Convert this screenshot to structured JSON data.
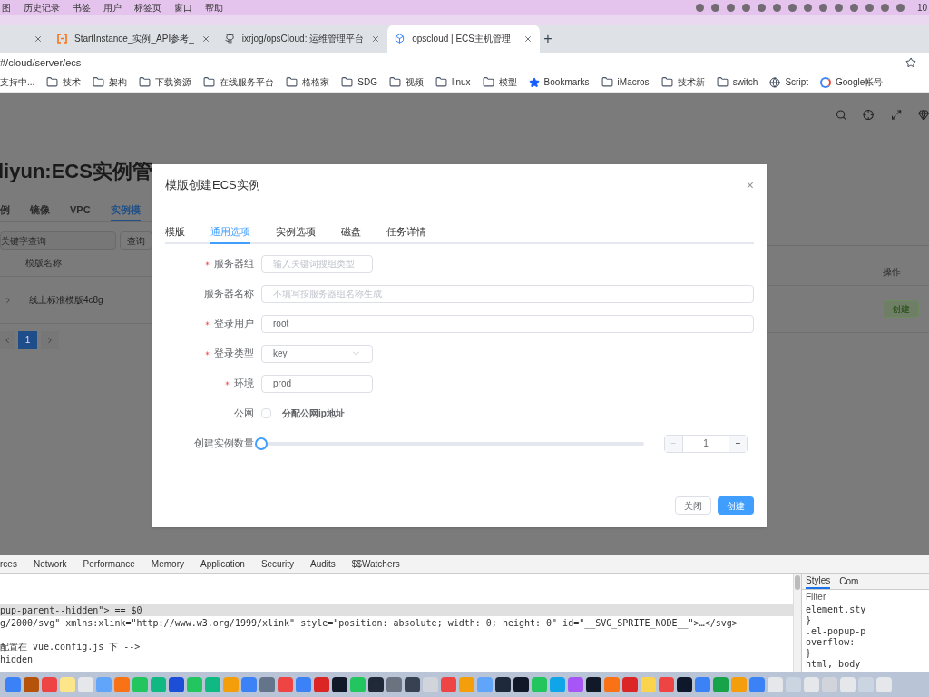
{
  "menu_bar": {
    "items": [
      "图",
      "历史记录",
      "书签",
      "用户",
      "标签页",
      "窗口",
      "帮助"
    ],
    "clock": "10"
  },
  "browser_tabs": [
    {
      "selected": false
    },
    {
      "title": "StartInstance_实例_API参考_",
      "selected": false
    },
    {
      "title": "ixrjog/opsCloud: 运维管理平台",
      "selected": false
    },
    {
      "title": "opscloud | ECS主机管理",
      "selected": true
    }
  ],
  "new_tab": "+",
  "address": "#/cloud/server/ecs",
  "bookmarks": [
    {
      "label": "支持中...",
      "kind": "text"
    },
    {
      "label": "技术",
      "kind": "folder"
    },
    {
      "label": "架构",
      "kind": "folder"
    },
    {
      "label": "下载资源",
      "kind": "folder"
    },
    {
      "label": "在线服务平台",
      "kind": "folder"
    },
    {
      "label": "格格家",
      "kind": "folder"
    },
    {
      "label": "SDG",
      "kind": "folder"
    },
    {
      "label": "视频",
      "kind": "folder"
    },
    {
      "label": "linux",
      "kind": "folder"
    },
    {
      "label": "模型",
      "kind": "folder"
    },
    {
      "label": "Bookmarks",
      "kind": "star"
    },
    {
      "label": "iMacros",
      "kind": "folder"
    },
    {
      "label": "技术新",
      "kind": "folder"
    },
    {
      "label": "switch",
      "kind": "folder"
    },
    {
      "label": "Script",
      "kind": "globe"
    },
    {
      "label": "Google帐号",
      "kind": "google"
    }
  ],
  "page": {
    "title": "liyun:ECS实例管",
    "tabs": [
      {
        "label": "例",
        "selected": false
      },
      {
        "label": "镜像",
        "selected": false
      },
      {
        "label": "VPC",
        "selected": false
      },
      {
        "label": "实例模",
        "selected": true
      }
    ],
    "search_placeholder": "关键字查询",
    "search_button": "查询",
    "columns": [
      "模版名称",
      "操作"
    ],
    "rows": [
      {
        "name": "线上标准模版4c8g",
        "action": "创建"
      }
    ],
    "pages": [
      {
        "label": "1",
        "selected": true
      }
    ]
  },
  "dialog": {
    "title": "模版创建ECS实例",
    "close": "×",
    "tabs": [
      {
        "label": "模版",
        "selected": false
      },
      {
        "label": "通用选项",
        "selected": true
      },
      {
        "label": "实例选项",
        "selected": false
      },
      {
        "label": "磁盘",
        "selected": false
      },
      {
        "label": "任务详情",
        "selected": false
      }
    ],
    "fields": [
      {
        "kind": "short",
        "label": "服务器组",
        "required": true,
        "placeholder": "输入关键词搜组类型"
      },
      {
        "kind": "wide",
        "label": "服务器名称",
        "required": false,
        "placeholder": "不填写按服务器组名称生成"
      },
      {
        "kind": "wide",
        "label": "登录用户",
        "required": true,
        "value": "root"
      },
      {
        "kind": "select",
        "label": "登录类型",
        "required": true,
        "value": "key"
      },
      {
        "kind": "short",
        "label": "环境",
        "required": true,
        "value": "prod"
      },
      {
        "kind": "checkbox",
        "label": "公网",
        "required": false,
        "checked": false,
        "text": "分配公网ip地址"
      },
      {
        "kind": "slider",
        "label": "创建实例数量",
        "required": false,
        "level": 0,
        "value": "1",
        "minus": "−",
        "plus": "+"
      }
    ],
    "buttons": [
      {
        "label": "关闭",
        "kind": "plain"
      },
      {
        "label": "创建",
        "kind": "primary"
      }
    ]
  },
  "devtools": {
    "tabs": [
      "rces",
      "Network",
      "Performance",
      "Memory",
      "Application",
      "Security",
      "Audits",
      "$$Watchers"
    ],
    "lines": [
      {
        "text": "pup-parent--hidden\"> == $0",
        "selected": true
      },
      {
        "text": "g/2000/svg\" xmlns:xlink=\"http://www.w3.org/1999/xlink\" style=\"position: absolute; width: 0; height: 0\" id=\"__SVG_SPRITE_NODE__\">…</svg>",
        "selected": false
      },
      {
        "text": "配置在 vue.config.js 下 -->",
        "selected": false
      },
      {
        "text": "hidden",
        "selected": false
      }
    ],
    "side_tabs": [
      {
        "label": "Styles",
        "selected": true
      },
      {
        "label": "Com",
        "selected": false
      }
    ],
    "filter_placeholder": "Filter",
    "styles": [
      "element.sty",
      "}",
      ".el-popup-p",
      "overflow:",
      "}",
      "html, body"
    ]
  }
}
